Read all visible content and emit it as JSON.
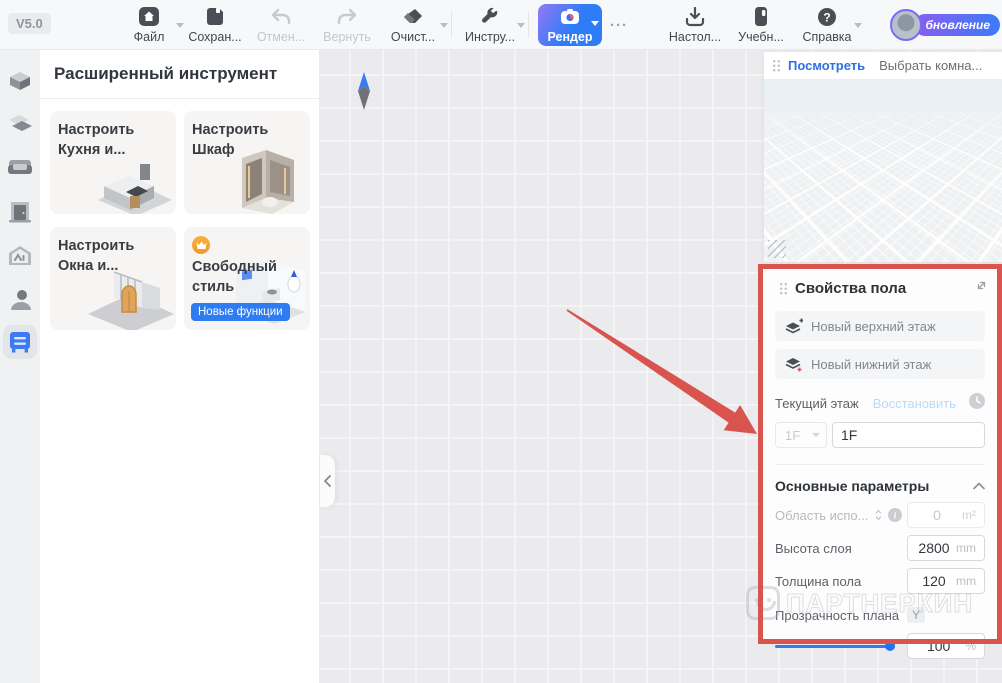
{
  "app": {
    "version": "V5.0"
  },
  "toolbar": {
    "file": "Файл",
    "save": "Сохран...",
    "undo": "Отмен...",
    "redo": "Вернуть",
    "clear": "Очист...",
    "tools": "Инстру...",
    "render": "Рендер",
    "more": "···",
    "desktop": "Настол...",
    "tutorial": "Учебн...",
    "help": "Справка",
    "update_badge": "бновление"
  },
  "sidebar": {
    "icons": [
      "walls-icon",
      "floors-icon",
      "furniture-icon",
      "door-icon",
      "ai-home-icon",
      "profile-icon",
      "cabinet-icon"
    ],
    "active_index": 6
  },
  "advanced_panel": {
    "title": "Расширенный инструмент",
    "cards": [
      {
        "title": "Настроить Кухня и..."
      },
      {
        "title": "Настроить Шкаф"
      },
      {
        "title": "Настроить Окна и..."
      },
      {
        "title": "Свободный стиль",
        "badge": "Новые функции",
        "premium_icon": "crown-icon"
      }
    ]
  },
  "viewport_panel": {
    "tabs": [
      {
        "label": "Посмотреть",
        "active": true
      },
      {
        "label": "Выбрать комна...",
        "active": false
      }
    ]
  },
  "floor_panel": {
    "title": "Свойства пола",
    "new_upper_floor": "Новый верхний этаж",
    "new_lower_floor": "Новый нижний этаж",
    "current_floor_label": "Текущий этаж",
    "restore_label": "Восстановить",
    "floor_select_value": "1F",
    "floor_name_value": "1F",
    "section_title": "Основные параметры",
    "area": {
      "label": "Область испо...",
      "value": "0",
      "unit": "m²",
      "disabled": true
    },
    "layer_height": {
      "label": "Высота слоя",
      "value": "2800",
      "unit": "mm"
    },
    "floor_thickness": {
      "label": "Толщина пола",
      "value": "120",
      "unit": "mm"
    },
    "opacity": {
      "label": "Прозрачность плана",
      "axis_badge": "Y",
      "value": "100",
      "unit": "%",
      "percent": 100
    }
  },
  "watermark": {
    "text": "ПАРТНЕРКИН"
  },
  "colors": {
    "accent": "#2f7bf0",
    "annotation_red": "#d9534f",
    "render_gradient_from": "#9479f6",
    "render_gradient_to": "#2e7cf6",
    "new_badge_blue": "#2f7bf0"
  }
}
